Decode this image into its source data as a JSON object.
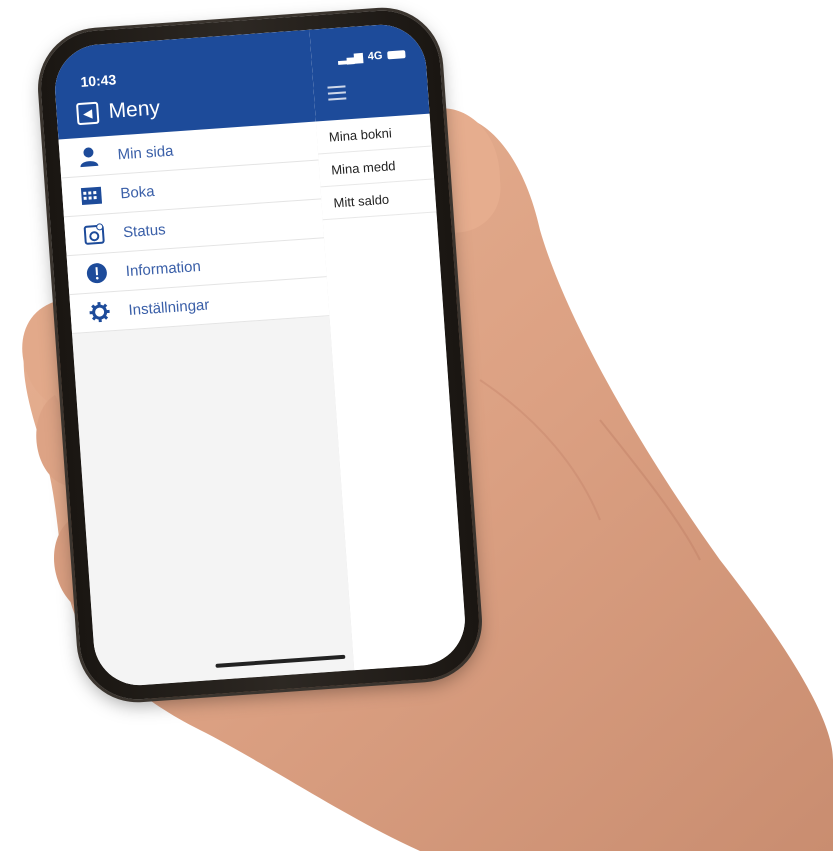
{
  "status_bar": {
    "time": "10:43",
    "network": "4G"
  },
  "drawer": {
    "title": "Meny",
    "items": [
      {
        "label": "Min sida",
        "icon": "user-icon"
      },
      {
        "label": "Boka",
        "icon": "calendar-icon"
      },
      {
        "label": "Status",
        "icon": "washing-machine-icon"
      },
      {
        "label": "Information",
        "icon": "info-icon"
      },
      {
        "label": "Inställningar",
        "icon": "gear-icon"
      }
    ]
  },
  "main": {
    "items": [
      {
        "label": "Mina bokni"
      },
      {
        "label": "Mina medd"
      },
      {
        "label": "Mitt saldo"
      }
    ]
  },
  "colors": {
    "brand": "#1d4b9a",
    "menu_text": "#3a5fa8"
  }
}
